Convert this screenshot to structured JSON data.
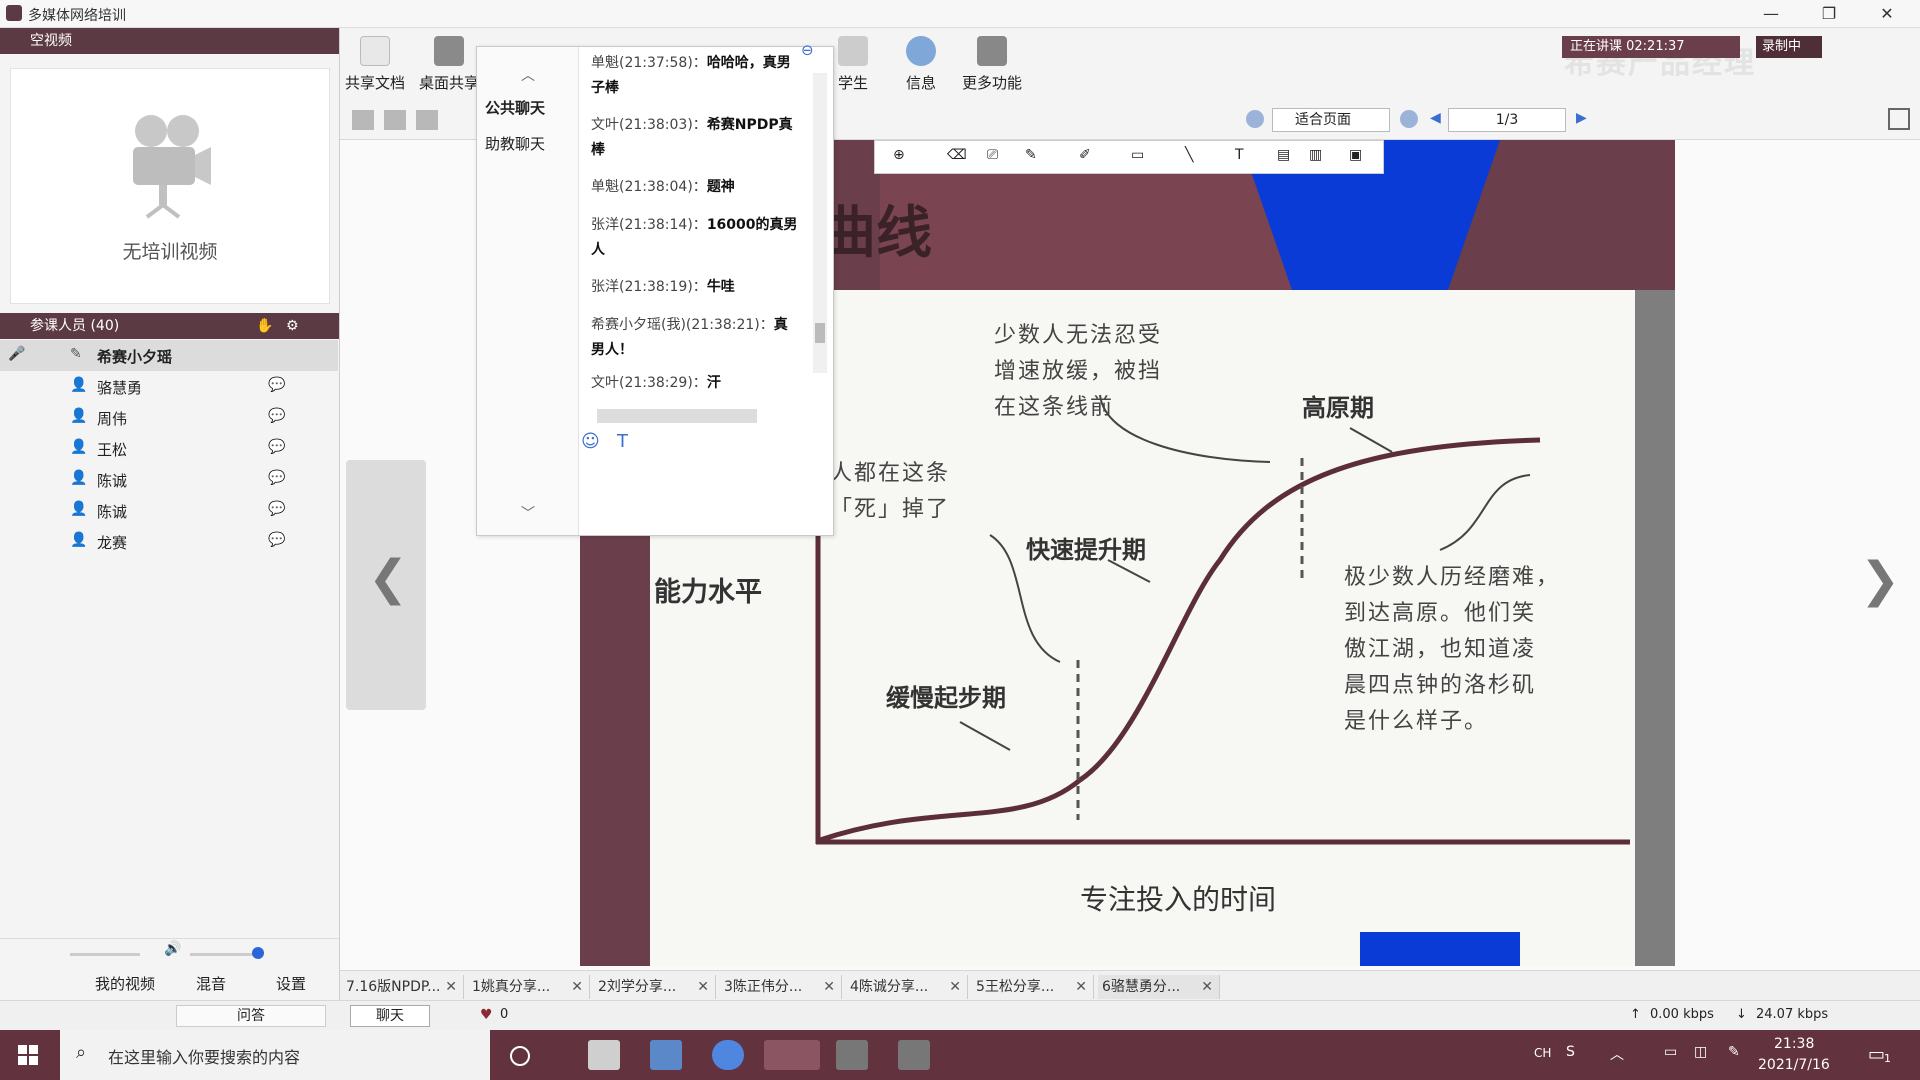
{
  "window": {
    "title": "多媒体网络培训",
    "minimize": "—",
    "maximize": "❐",
    "close": "✕"
  },
  "left": {
    "video_header": "空视频",
    "no_video_text": "无培训视频",
    "participants_header": "参课人员 (40)",
    "participants": [
      {
        "name": "希赛小夕瑶"
      },
      {
        "name": "骆慧勇"
      },
      {
        "name": "周伟"
      },
      {
        "name": "王松"
      },
      {
        "name": "陈诚"
      },
      {
        "name": "陈诚"
      },
      {
        "name": "龙赛"
      }
    ],
    "my_video": "我的视频",
    "mix": "混音",
    "settings": "设置",
    "qa": "问答"
  },
  "toolbar": {
    "share_doc": "共享文档",
    "desktop_share": "桌面共享",
    "student": "学生",
    "info": "信息",
    "more": "更多功能",
    "live_status": "正在讲课 02:21:37",
    "record": "录制中",
    "fit_page": "适合页面",
    "page_indicator": "1/3",
    "watermark": "希赛产品经理"
  },
  "chat": {
    "tab_public": "公共聊天",
    "tab_assistant": "助教聊天",
    "messages": [
      {
        "from": "单魁(21:37:58)：",
        "text": "哈哈哈，真男子棒"
      },
      {
        "from": "文叶(21:38:03)：",
        "text": "希赛NPDP真棒"
      },
      {
        "from": "单魁(21:38:04)：",
        "text": "题神"
      },
      {
        "from": "张洋(21:38:14)：",
        "text": "16000的真男人"
      },
      {
        "from": "张洋(21:38:19)：",
        "text": "牛哇"
      },
      {
        "from": "希赛小夕瑶(我)(21:38:21)：",
        "text": "真男人！"
      },
      {
        "from": "文叶(21:38:29)：",
        "text": "汗"
      }
    ]
  },
  "slide": {
    "title_fragment": "曲线",
    "y_label": "能力水平",
    "x_label": "专注投入的时间",
    "phase_slow": "缓慢起步期",
    "phase_fast": "快速提升期",
    "phase_plateau": "高原期",
    "note_top": [
      "少数人无法忍受",
      "增速放缓，被挡",
      "在这条线前"
    ],
    "note_left": [
      "人都在这条",
      "「死」掉了"
    ],
    "note_right": [
      "极少数人历经磨难，",
      "到达高原。他们笑",
      "傲江湖，也知道凌",
      "晨四点钟的洛杉矶",
      "是什么样子。"
    ]
  },
  "doc_tabs": [
    {
      "label": "7.16版NPDP..."
    },
    {
      "label": "1姚真分享..."
    },
    {
      "label": "2刘学分享..."
    },
    {
      "label": "3陈正伟分..."
    },
    {
      "label": "4陈诚分享..."
    },
    {
      "label": "5王松分享..."
    },
    {
      "label": "6骆慧勇分..."
    }
  ],
  "status": {
    "chat_btn": "聊天",
    "likes": "0",
    "upload": "0.00 kbps",
    "download": "24.07 kbps"
  },
  "taskbar": {
    "search_placeholder": "在这里输入你要搜索的内容",
    "ime": "CH",
    "time": "21:38",
    "date": "2021/7/16",
    "notif_count": "1"
  },
  "colors": {
    "maroon": "#5b3a43",
    "taskbar": "#62333f",
    "accent_blue": "#0b3bd6"
  }
}
